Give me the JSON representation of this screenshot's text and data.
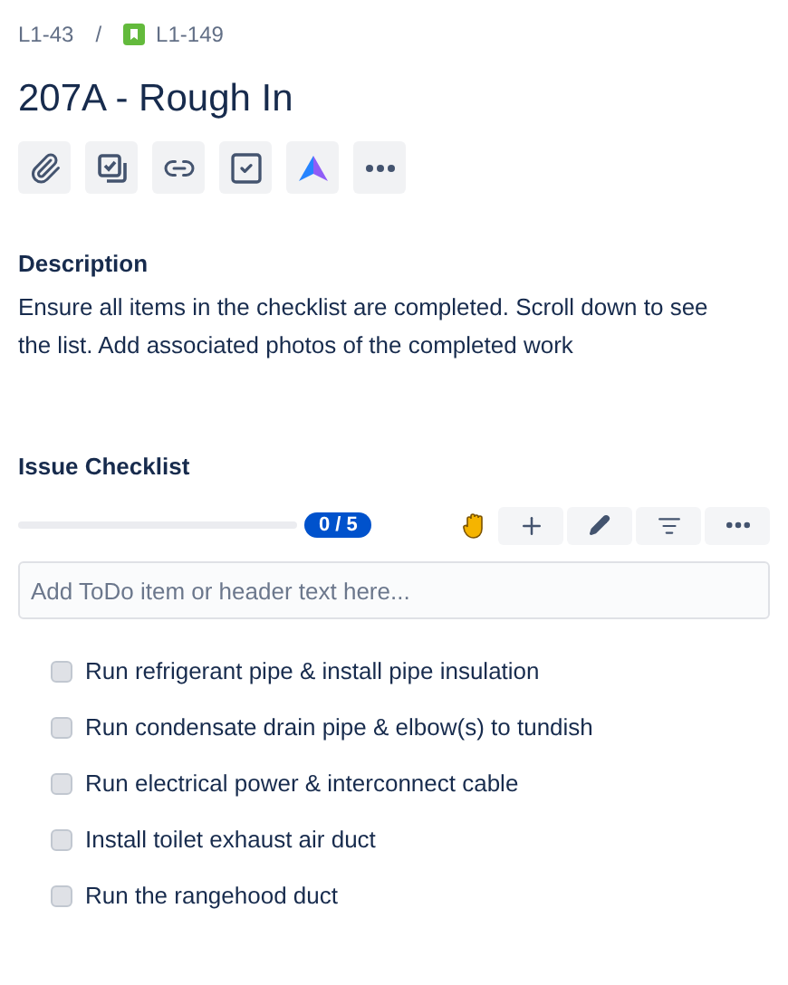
{
  "breadcrumb": [
    {
      "label": "L1-43",
      "kind": "plain"
    },
    {
      "label": "L1-149",
      "kind": "story"
    }
  ],
  "breadcrumb_separator": "/",
  "title": "207A - Rough In",
  "toolbar": [
    {
      "kind": "attach"
    },
    {
      "kind": "subtasks"
    },
    {
      "kind": "link"
    },
    {
      "kind": "checklist"
    },
    {
      "kind": "app"
    },
    {
      "kind": "more"
    }
  ],
  "description": {
    "label": "Description",
    "text": "Ensure all items in the checklist are completed. Scroll down to see the list. Add associated photos of the completed work"
  },
  "checklist": {
    "label": "Issue Checklist",
    "progress": {
      "level": 0,
      "reading": "0 / 5"
    },
    "actions": [
      {
        "kind": "hand"
      },
      {
        "kind": "add"
      },
      {
        "kind": "edit"
      },
      {
        "kind": "filter"
      },
      {
        "kind": "more"
      }
    ],
    "input": {
      "placeholder": "Add ToDo item or header text here..."
    },
    "items": [
      {
        "text": "Run refrigerant pipe & install pipe insulation",
        "checked": false
      },
      {
        "text": "Run condensate drain pipe & elbow(s) to tundish",
        "checked": false
      },
      {
        "text": "Run electrical power & interconnect cable",
        "checked": false
      },
      {
        "text": "Install toilet exhaust air duct",
        "checked": false
      },
      {
        "text": "Run the rangehood duct",
        "checked": false
      }
    ]
  }
}
